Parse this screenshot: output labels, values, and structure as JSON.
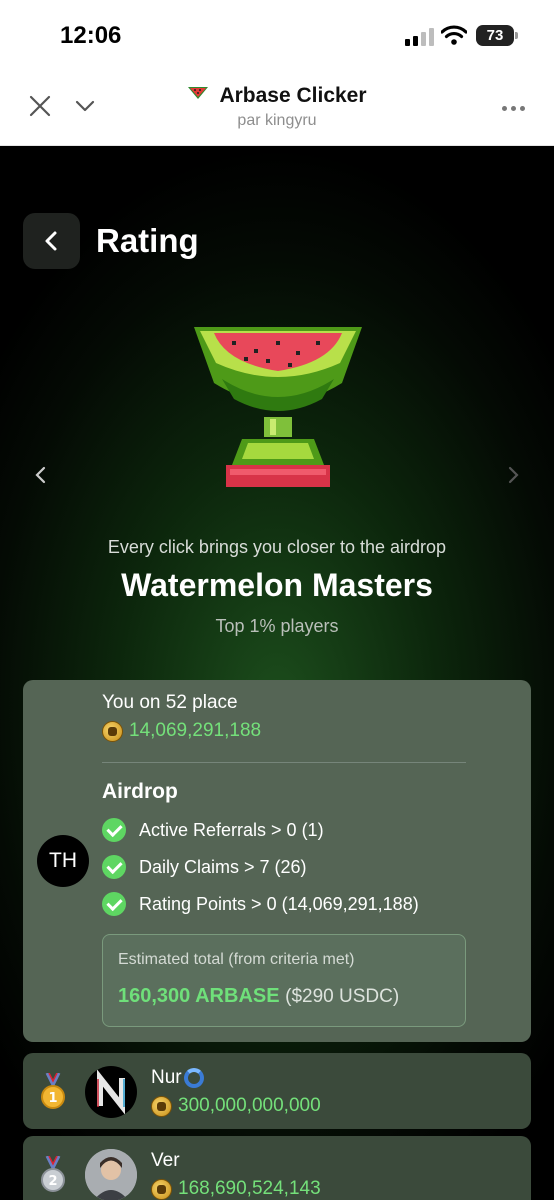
{
  "status_bar": {
    "time": "12:06",
    "battery": "73"
  },
  "browser": {
    "title": "Arbase Clicker",
    "subtitle": "par kingyru"
  },
  "page": {
    "title": "Rating",
    "tagline": "Every click brings you closer to the airdrop",
    "league": "Watermelon Masters",
    "league_sub": "Top 1% players"
  },
  "user": {
    "avatar": "TH",
    "place": "You on 52 place",
    "coins": "14,069,291,188"
  },
  "airdrop": {
    "title": "Airdrop",
    "criteria": [
      "Active Referrals > 0 (1)",
      "Daily Claims > 7 (26)",
      "Rating Points > 0 (14,069,291,188)"
    ],
    "estimate_label": "Estimated total (from criteria met)",
    "estimate_value": "160,300 ARBASE",
    "estimate_usd": "($290 USDC)"
  },
  "leaderboard": [
    {
      "rank": "1",
      "name": "Nur",
      "coins": "300,000,000,000"
    },
    {
      "rank": "2",
      "name": "Ver",
      "coins": "168,690,524,143"
    }
  ],
  "colors": {
    "accent_green": "#74e07a",
    "card_bg": "#556555",
    "row_bg": "#3b4a3b"
  },
  "icons": [
    "close-icon",
    "chevron-down-icon",
    "watermelon-icon",
    "more-icon",
    "back-arrow-icon",
    "trophy-image",
    "check-icon",
    "coin-icon",
    "medal-icon",
    "swirl-emoji-icon"
  ]
}
